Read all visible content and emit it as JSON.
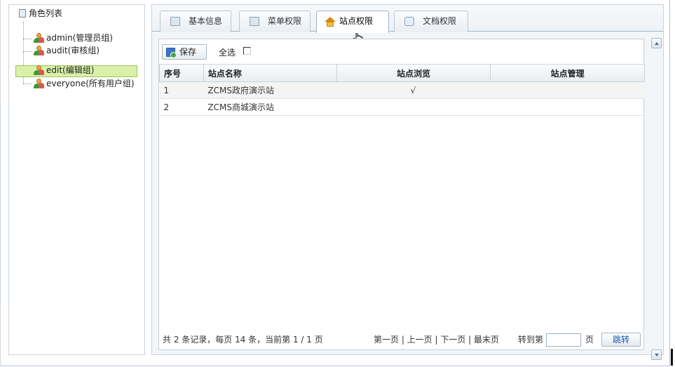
{
  "tree": {
    "root_label": "角色列表",
    "items": [
      {
        "label": "admin(管理员组)"
      },
      {
        "label": "audit(审核组)"
      },
      {
        "label": "edit(编辑组)",
        "selected": true
      },
      {
        "label": "everyone(所有用户组)"
      }
    ]
  },
  "tabs": [
    {
      "label": "基本信息",
      "icon": "form-icon"
    },
    {
      "label": "菜单权限",
      "icon": "form-icon"
    },
    {
      "label": "站点权限",
      "icon": "home-icon",
      "active": true
    },
    {
      "label": "文档权限",
      "icon": "document-icon"
    }
  ],
  "toolbar": {
    "save_label": "保存",
    "select_all_label": "全选"
  },
  "table": {
    "columns": [
      "序号",
      "站点名称",
      "站点浏览",
      "站点管理"
    ],
    "rows": [
      {
        "no": "1",
        "name": "ZCMS政府演示站",
        "browse": "√",
        "manage": ""
      },
      {
        "no": "2",
        "name": "ZCMS商城演示站",
        "browse": "",
        "manage": ""
      }
    ]
  },
  "pager": {
    "summary": "共 2 条记录，每页 14 条，当前第 1 / 1 页",
    "nav": "第一页 | 上一页 | 下一页 | 最末页",
    "goto_label": "转到第",
    "page_label": "页",
    "goto_value": "",
    "jump_label": "跳转"
  },
  "colors": {
    "selected_row_bg": "#d9f0a9",
    "border": "#c9d3dd",
    "link_blue": "#1a56b5"
  }
}
